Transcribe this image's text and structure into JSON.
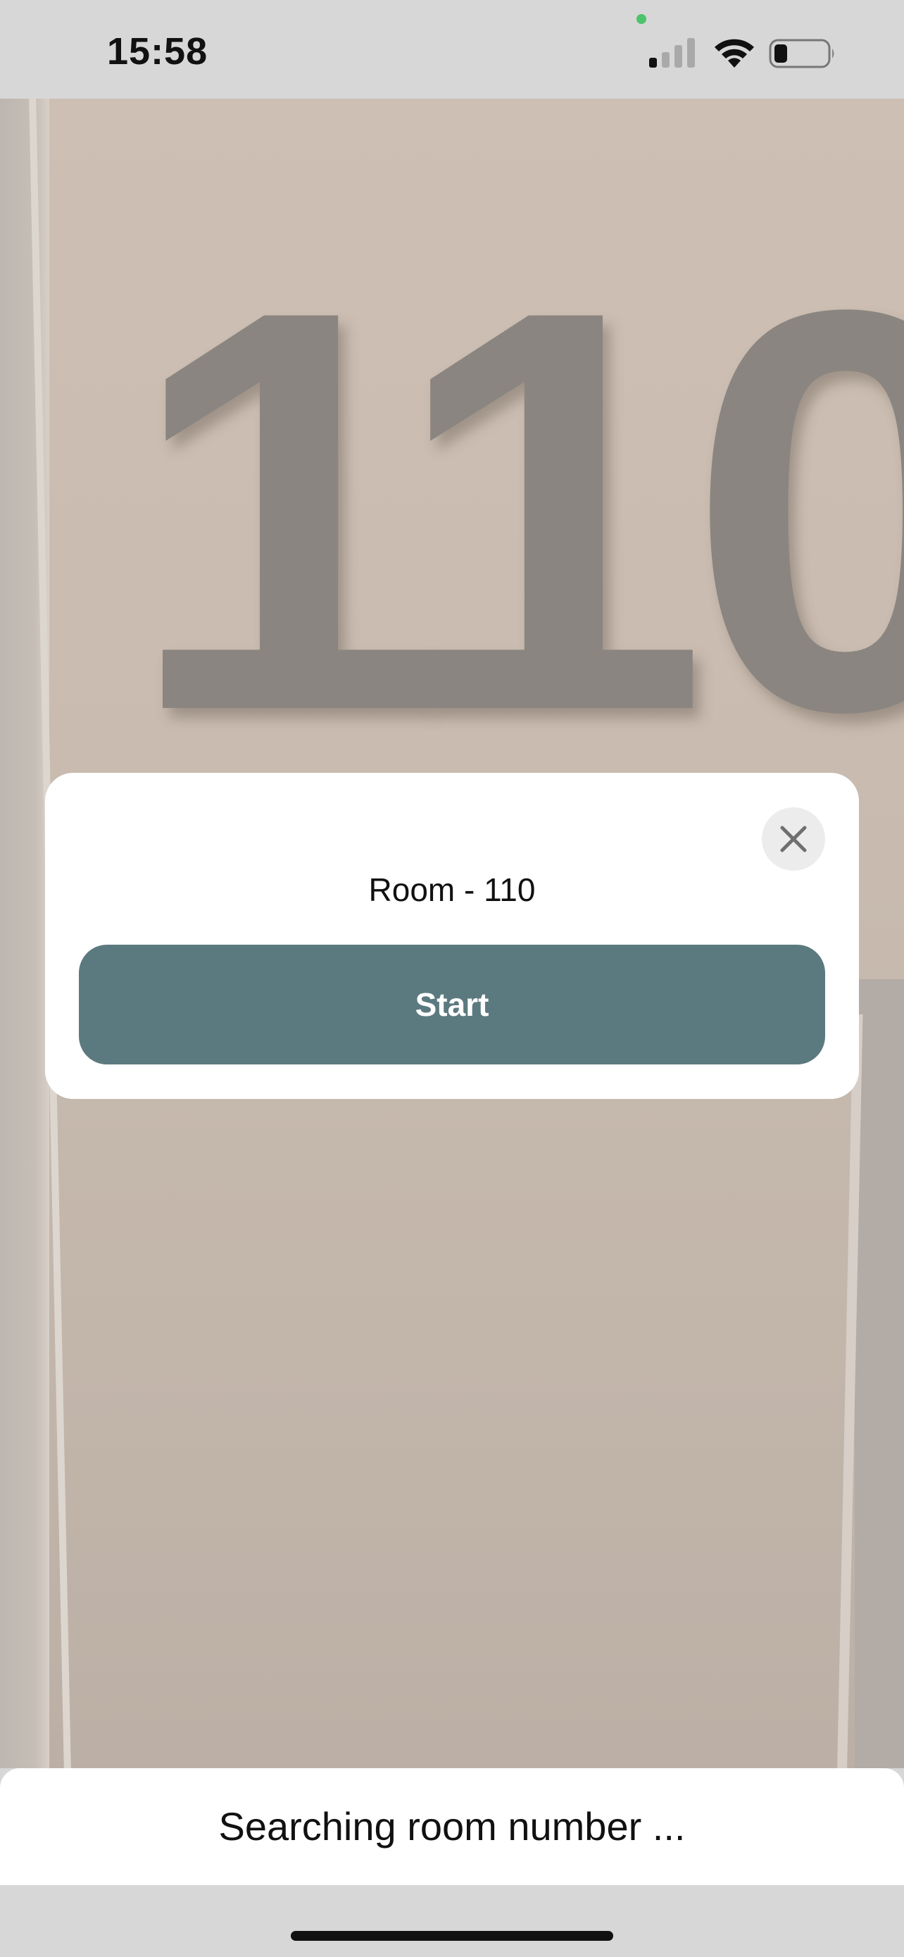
{
  "status_bar": {
    "time": "15:58",
    "signal_icon": "cellular-signal-icon",
    "wifi_icon": "wifi-icon",
    "battery_icon": "battery-icon",
    "battery_level": 0.25,
    "privacy_indicator_color": "#4cc46a"
  },
  "camera": {
    "sign_text": "110"
  },
  "dialog": {
    "title": "Room - 110",
    "close_icon": "close-icon",
    "start_label": "Start"
  },
  "bottom_sheet": {
    "status_text": "Searching room number ..."
  },
  "colors": {
    "accent": "#5b7a7f",
    "surface": "#ffffff",
    "system_bar": "#d7d7d7"
  }
}
